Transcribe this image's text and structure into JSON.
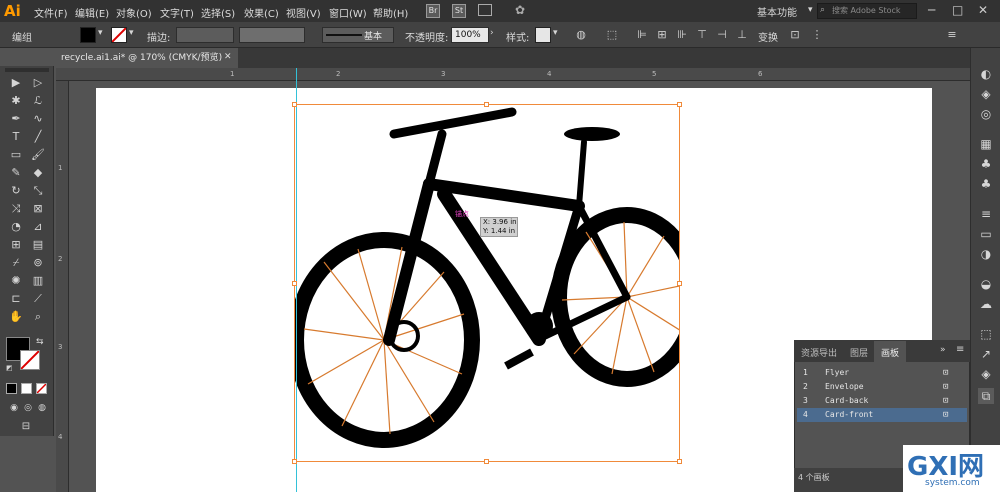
{
  "app": {
    "logo": "Ai"
  },
  "menus": [
    "文件(F)",
    "编辑(E)",
    "对象(O)",
    "文字(T)",
    "选择(S)",
    "效果(C)",
    "视图(V)",
    "窗口(W)",
    "帮助(H)"
  ],
  "bridge_labels": [
    "Br",
    "St"
  ],
  "workspace": "基本功能",
  "search_placeholder": "搜索 Adobe Stock",
  "control_bar": {
    "mode_label": "编组",
    "stroke_label": "描边:",
    "stroke_style": "基本",
    "opacity_label": "不透明度:",
    "opacity_value": "100%",
    "style_label": "样式:",
    "transform_label": "变换"
  },
  "document_tab": "recycle.ai1.ai* @ 170% (CMYK/预览)",
  "ruler_top": [
    "1",
    "2",
    "3",
    "4",
    "5",
    "6"
  ],
  "ruler_left": [
    "1",
    "2",
    "3",
    "4"
  ],
  "coordinate_tooltip": {
    "x": "X: 3.96 in",
    "y": "Y: 1.44 in"
  },
  "anchor_hint": "锚点",
  "artboards_panel": {
    "tabs": [
      "资源导出",
      "图层",
      "画板"
    ],
    "rows": [
      {
        "num": "1",
        "name": "Flyer"
      },
      {
        "num": "2",
        "name": "Envelope"
      },
      {
        "num": "3",
        "name": "Card-back"
      },
      {
        "num": "4",
        "name": "Card-front"
      }
    ],
    "footer": "4 个画板"
  },
  "watermark": {
    "text": "GXI网",
    "sub": "system.com"
  },
  "colors": {
    "accent": "#f08a3a",
    "guide": "#33c1d8",
    "selection": "#4b6b8f",
    "logo": "#ff9a00"
  }
}
